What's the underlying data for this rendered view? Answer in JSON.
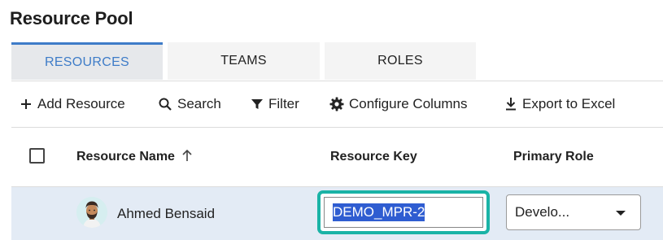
{
  "page": {
    "title": "Resource Pool"
  },
  "tabs": [
    {
      "label": "RESOURCES",
      "active": true
    },
    {
      "label": "TEAMS",
      "active": false
    },
    {
      "label": "ROLES",
      "active": false
    }
  ],
  "toolbar": {
    "add_label": "Add Resource",
    "search_label": "Search",
    "filter_label": "Filter",
    "config_label": "Configure Columns",
    "export_label": "Export to Excel",
    "icons": [
      "plus-icon",
      "search-icon",
      "filter-icon",
      "gear-icon",
      "download-icon"
    ]
  },
  "table": {
    "columns": {
      "name": "Resource Name",
      "key": "Resource Key",
      "role": "Primary Role"
    },
    "sort_icon": "arrow-up-icon",
    "rows": [
      {
        "name": "Ahmed Bensaid",
        "key": "DEMO_MPR-2",
        "role": "Develo..."
      }
    ]
  },
  "colors": {
    "accent": "#3e7cc8",
    "focus_ring": "#1ab3a6",
    "row_highlight": "#e3ebf5",
    "selection": "#2f5dd1"
  }
}
